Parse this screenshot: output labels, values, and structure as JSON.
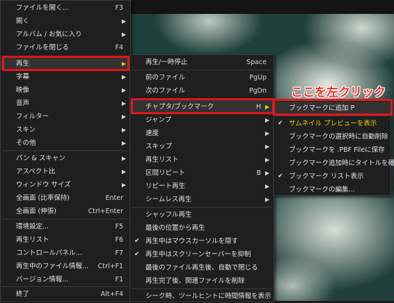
{
  "menu_main": {
    "items": [
      {
        "label": "ファイルを開く...",
        "key": "F3"
      },
      {
        "label": "開く",
        "key": ""
      },
      {
        "label": "アルバム / お気に入り",
        "key": ""
      },
      {
        "label": "ファイルを閉じる",
        "key": "F4"
      },
      {
        "label": "再生",
        "key": ""
      },
      {
        "label": "字幕",
        "key": ""
      },
      {
        "label": "映像",
        "key": ""
      },
      {
        "label": "音声",
        "key": ""
      },
      {
        "label": "フィルター",
        "key": ""
      },
      {
        "label": "スキン",
        "key": ""
      },
      {
        "label": "その他",
        "key": ""
      },
      {
        "label": "パン & スキャン",
        "key": ""
      },
      {
        "label": "アスペクト比",
        "key": ""
      },
      {
        "label": "ウィンドウ サイズ",
        "key": ""
      },
      {
        "label": "全画面 (比率保持)",
        "key": "Enter"
      },
      {
        "label": "全画面 (伸張)",
        "key": "Ctrl+Enter"
      },
      {
        "label": "環境設定...",
        "key": "F5"
      },
      {
        "label": "再生リスト",
        "key": "F6"
      },
      {
        "label": "コントロールパネル...",
        "key": "F7"
      },
      {
        "label": "再生中のファイル情報...",
        "key": "Ctrl+F1"
      },
      {
        "label": "バージョン情報...",
        "key": "F1"
      },
      {
        "label": "終了",
        "key": "Alt+F4"
      }
    ]
  },
  "menu_play": {
    "items": [
      {
        "label": "再生/一時停止",
        "key": "Space"
      },
      {
        "label": "前のファイル",
        "key": "PgUp"
      },
      {
        "label": "次のファイル",
        "key": "PgDn"
      },
      {
        "label": "チャプタ/ブックマーク",
        "key": "H"
      },
      {
        "label": "ジャンプ",
        "key": ""
      },
      {
        "label": "速度",
        "key": ""
      },
      {
        "label": "スキップ",
        "key": ""
      },
      {
        "label": "再生リスト",
        "key": ""
      },
      {
        "label": "区間リピート",
        "key": "B"
      },
      {
        "label": "リピート再生",
        "key": ""
      },
      {
        "label": "シームレス再生",
        "key": ""
      },
      {
        "label": "シャッフル再生",
        "key": ""
      },
      {
        "label": "最後の位置から再生",
        "key": ""
      },
      {
        "label": "再生中はマウスカーソルを隠す",
        "key": ""
      },
      {
        "label": "再生中はスクリーンセーバーを抑制",
        "key": ""
      },
      {
        "label": "最後のファイル再生後、自動で閉じる",
        "key": ""
      },
      {
        "label": "再生完了後、関連ファイルを削除",
        "key": ""
      },
      {
        "label": "シーク時、ツールヒントに時間情報を表示",
        "key": ""
      }
    ]
  },
  "menu_bookmark": {
    "items": [
      {
        "label": "ブックマークに追加 P"
      },
      {
        "label": "サムネイル プレビューを表示"
      },
      {
        "label": "ブックマークの選択時に自動削除"
      },
      {
        "label": "ブックマークを .PBF Fileに保存"
      },
      {
        "label": "ブックマーク追加時にタイトルを確認"
      },
      {
        "label": "ブックマーク リスト表示"
      },
      {
        "label": "ブックマークの編集..."
      }
    ]
  },
  "callout": "ここを左クリック",
  "colors": {
    "annotation_red": "#e0161c",
    "highlight_yellow": "#e8d000"
  }
}
